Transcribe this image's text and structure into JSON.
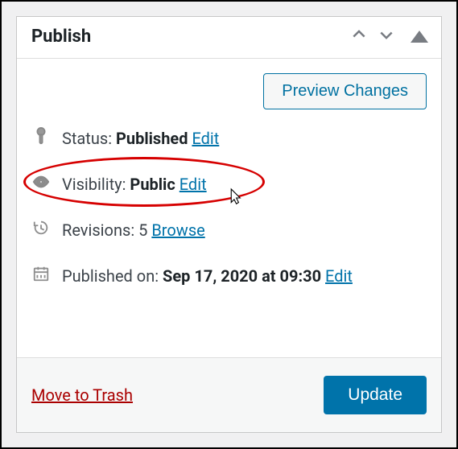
{
  "panel": {
    "title": "Publish"
  },
  "preview": {
    "label": "Preview Changes"
  },
  "status": {
    "label": "Status:",
    "value": "Published",
    "edit": "Edit"
  },
  "visibility": {
    "label": "Visibility:",
    "value": "Public",
    "edit": "Edit"
  },
  "revisions": {
    "label": "Revisions:",
    "count": "5",
    "browse": "Browse"
  },
  "published_on": {
    "label": "Published on:",
    "value": "Sep 17, 2020 at 09:30",
    "edit": "Edit"
  },
  "footer": {
    "trash": "Move to Trash",
    "update": "Update"
  }
}
